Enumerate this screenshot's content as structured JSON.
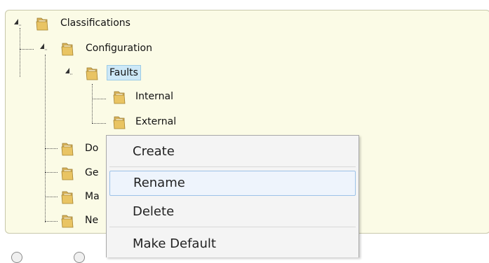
{
  "tree": {
    "root": "Classifications",
    "configuration": "Configuration",
    "faults": "Faults",
    "internal": "Internal",
    "external": "External",
    "do": "Do",
    "ge": "Ge",
    "ma": "Ma",
    "ne": "Ne"
  },
  "context_menu": {
    "items": [
      "Create",
      "Rename",
      "Delete",
      "Make Default"
    ]
  },
  "colors": {
    "panel_bg": "#fbfbe6",
    "selection": "#cde8f7",
    "menu_hover": "#eef4fc"
  }
}
